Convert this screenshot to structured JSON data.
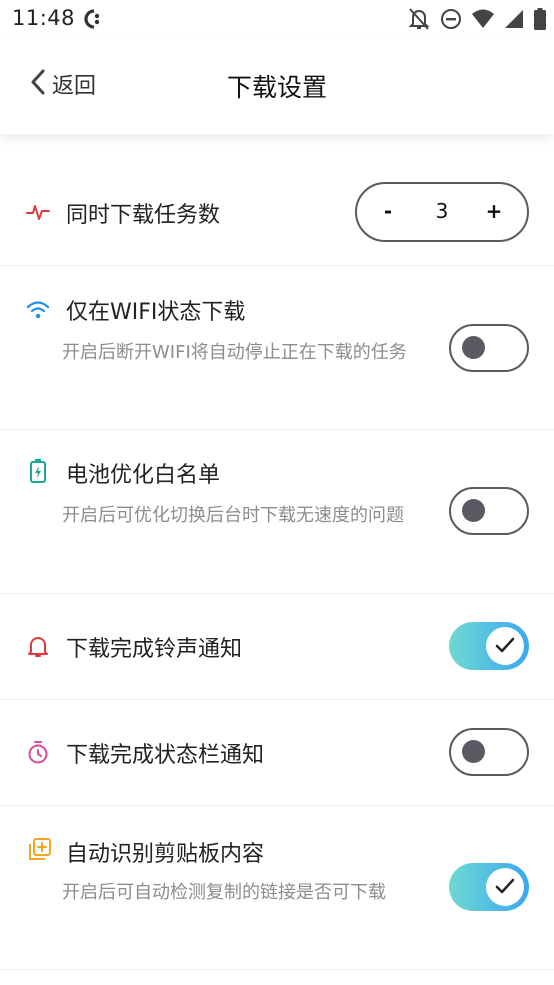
{
  "status_bar": {
    "time": "11:48"
  },
  "header": {
    "back_label": "返回",
    "title": "下载设置"
  },
  "settings": {
    "concurrent": {
      "title": "同时下载任务数",
      "minus": "-",
      "value": "3",
      "plus": "+"
    },
    "wifi_only": {
      "title": "仅在WIFI状态下载",
      "desc": "开启后断开WIFI将自动停止正在下载的任务",
      "enabled": false
    },
    "battery": {
      "title": "电池优化白名单",
      "desc": "开启后可优化切换后台时下载无速度的问题",
      "enabled": false
    },
    "ringtone": {
      "title": "下载完成铃声通知",
      "enabled": true
    },
    "statusbar_notify": {
      "title": "下载完成状态栏通知",
      "enabled": false
    },
    "clipboard": {
      "title": "自动识别剪贴板内容",
      "desc": "开启后可自动检测复制的链接是否可下载",
      "enabled": true
    }
  },
  "colors": {
    "toggle_on_start": "#6fd8d2",
    "toggle_on_end": "#3aa8f0",
    "toggle_off": "#5a5a62",
    "icon_red": "#e0383e",
    "icon_blue": "#1e8ef0",
    "icon_teal": "#17a89a",
    "icon_pink": "#e0489a",
    "icon_orange": "#f5a623"
  }
}
